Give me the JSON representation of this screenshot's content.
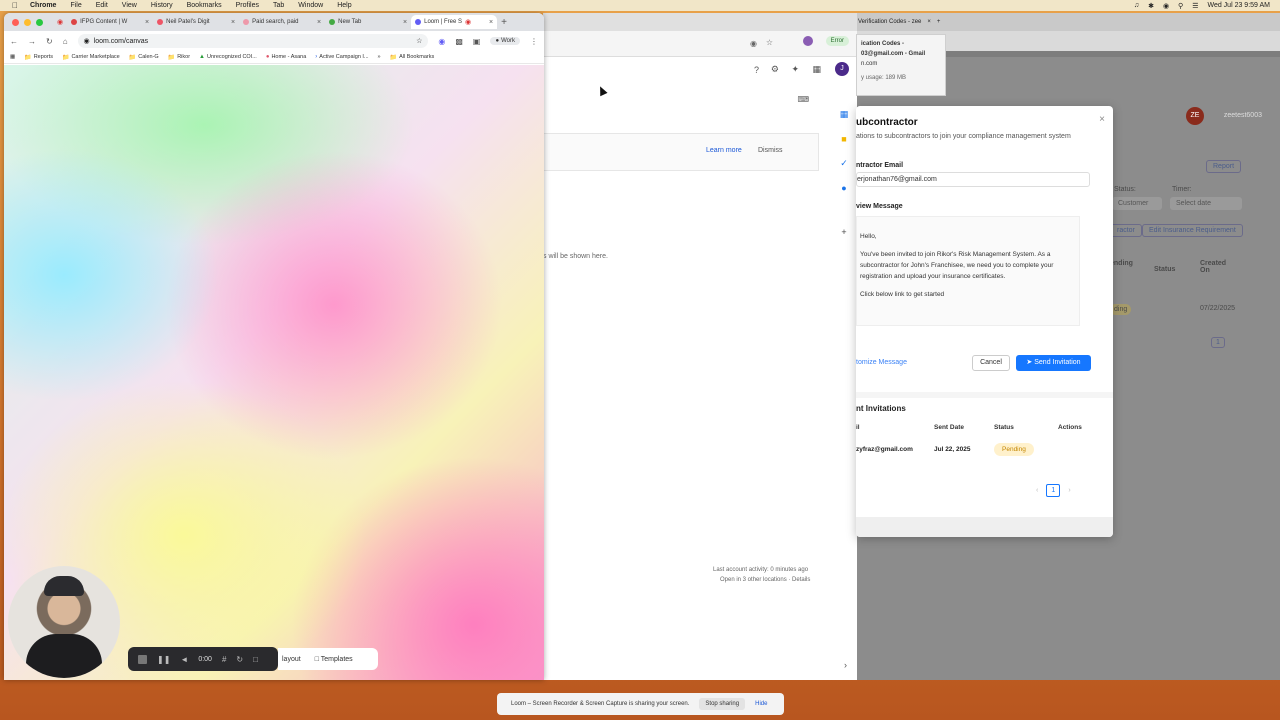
{
  "menubar": {
    "app": "Chrome",
    "items": [
      "File",
      "Edit",
      "View",
      "History",
      "Bookmarks",
      "Profiles",
      "Tab",
      "Window",
      "Help"
    ],
    "datetime": "Wed Jul 23  9:59 AM"
  },
  "front_window": {
    "tabs": [
      {
        "label": "IFPG Content | W",
        "color": "#d44"
      },
      {
        "label": "Neil Patel's Digit",
        "color": "#e56"
      },
      {
        "label": "Paid search, paid",
        "color": "#e9a"
      },
      {
        "label": "New Tab",
        "color": "#4a4"
      },
      {
        "label": "Loom | Free S",
        "color": "#625df5"
      }
    ],
    "address": "loom.com/canvas",
    "profile": "Work",
    "bookmarks": [
      "Reports",
      "Carrier Marketplace",
      "Calen-G",
      "Rikor",
      "Unrecognized COI...",
      "Home - Asana",
      "Active Campaign I...",
      "All Bookmarks"
    ]
  },
  "loom": {
    "timer": "0:00",
    "layout_label": "layout",
    "templates_label": "Templates"
  },
  "mid_window": {
    "learn_more": "Learn more",
    "dismiss": "Dismiss",
    "empty_text": "s will be shown here.",
    "activity": "Last account activity: 0 minutes ago",
    "other_locations": "Open in 3 other locations · Details",
    "error_label": "Error"
  },
  "gmail_popup": {
    "line1": "ication Codes -",
    "line2": "03@gmail.com - Gmail",
    "line3": "n.com",
    "line4": "y usage: 189 MB"
  },
  "right_window": {
    "tab_label": "Verification Codes - zee",
    "user": "zeetest6003",
    "avatar": "ZE",
    "report": "Report",
    "status_label": "Status:",
    "timer_label": "Timer:",
    "customer": "Customer",
    "select_date": "Select date",
    "contractor": "ractor",
    "edit_insurance": "Edit Insurance Requirement",
    "col_pending": "ending",
    "col_status": "Status",
    "col_created": "Created On",
    "row_badge": "ding",
    "row_date": "07/22/2025",
    "page": "1"
  },
  "modal": {
    "title": "ubcontractor",
    "subtitle": "ations to subcontractors to join your compliance management system",
    "email_label": "ntractor Email",
    "email_value": "erjonathan76@gmail.com",
    "preview_label": "view Message",
    "greeting": "Hello,",
    "body": "You've been invited to join Rikor's Risk Management System. As a subcontractor for John's Franchisee, we need you to complete your registration and upload your insurance certificates.",
    "cta": "Click below link to get started",
    "customize": "tomize Message",
    "cancel": "Cancel",
    "send": "Send Invitation",
    "invitations_title": "nt Invitations",
    "columns": [
      "il",
      "Sent Date",
      "Status",
      "Actions"
    ],
    "rows": [
      {
        "email": "zyfraz@gmail.com",
        "date": "Jul 22, 2025",
        "status": "Pending"
      }
    ],
    "page": "1"
  },
  "share_banner": {
    "text": "Loom – Screen Recorder & Screen Capture is sharing your screen.",
    "stop": "Stop sharing",
    "hide": "Hide"
  }
}
